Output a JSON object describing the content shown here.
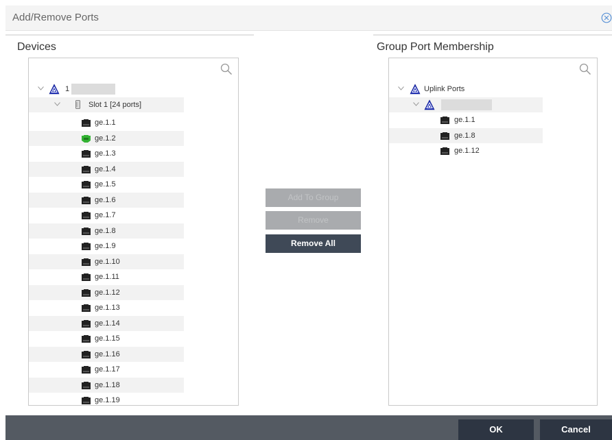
{
  "dialog": {
    "title": "Add/Remove Ports"
  },
  "devices": {
    "heading": "Devices",
    "device_label": "1",
    "slot_label": "Slot 1 [24 ports]",
    "ports": [
      {
        "label": "ge.1.1",
        "status": "down"
      },
      {
        "label": "ge.1.2",
        "status": "up"
      },
      {
        "label": "ge.1.3",
        "status": "down"
      },
      {
        "label": "ge.1.4",
        "status": "down"
      },
      {
        "label": "ge.1.5",
        "status": "down"
      },
      {
        "label": "ge.1.6",
        "status": "down"
      },
      {
        "label": "ge.1.7",
        "status": "down"
      },
      {
        "label": "ge.1.8",
        "status": "down"
      },
      {
        "label": "ge.1.9",
        "status": "down"
      },
      {
        "label": "ge.1.10",
        "status": "down"
      },
      {
        "label": "ge.1.11",
        "status": "down"
      },
      {
        "label": "ge.1.12",
        "status": "down"
      },
      {
        "label": "ge.1.13",
        "status": "down"
      },
      {
        "label": "ge.1.14",
        "status": "down"
      },
      {
        "label": "ge.1.15",
        "status": "down"
      },
      {
        "label": "ge.1.16",
        "status": "down"
      },
      {
        "label": "ge.1.17",
        "status": "down"
      },
      {
        "label": "ge.1.18",
        "status": "down"
      },
      {
        "label": "ge.1.19",
        "status": "down"
      }
    ]
  },
  "actions": {
    "add_to_group": "Add To Group",
    "remove": "Remove",
    "remove_all": "Remove All"
  },
  "membership": {
    "heading": "Group Port Membership",
    "group_label": "Uplink Ports",
    "ports": [
      {
        "label": "ge.1.1",
        "status": "down"
      },
      {
        "label": "ge.1.8",
        "status": "down"
      },
      {
        "label": "ge.1.12",
        "status": "down"
      }
    ]
  },
  "footer": {
    "ok": "OK",
    "cancel": "Cancel"
  },
  "colors": {
    "port_down": "#222222",
    "port_up": "#33b233",
    "device_triangle": "#1f2fb7",
    "button_dark": "#3f4957",
    "button_disabled": "#a9abae",
    "footer_bar": "#545a62",
    "footer_button": "#2d3542"
  },
  "icons": {
    "close": "close-circle-icon",
    "search": "magnifier-icon",
    "device": "blue-triangle-device-icon",
    "slot": "slot-card-icon",
    "port": "ethernet-port-icon",
    "expand": "chevron-down-icon"
  }
}
